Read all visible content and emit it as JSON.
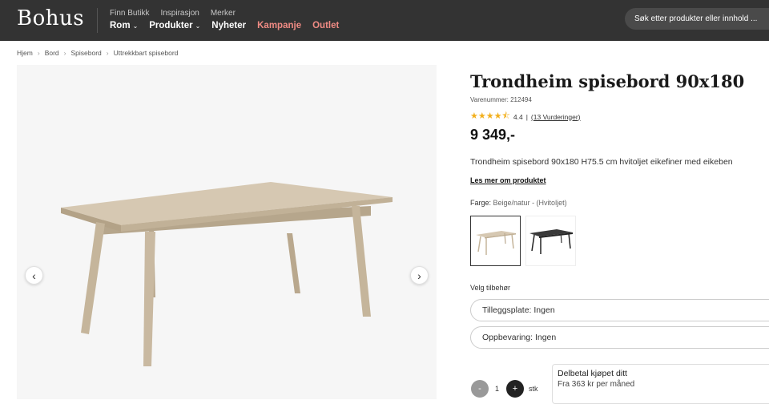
{
  "header": {
    "logo": "Bohus",
    "top_links": [
      "Finn Butikk",
      "Inspirasjon",
      "Merker"
    ],
    "nav": {
      "rom": "Rom",
      "produkter": "Produkter",
      "nyheter": "Nyheter",
      "kampanje": "Kampanje",
      "outlet": "Outlet"
    },
    "search_placeholder": "Søk etter produkter eller innhold ..."
  },
  "breadcrumb": [
    "Hjem",
    "Bord",
    "Spisebord",
    "Uttrekkbart spisebord"
  ],
  "product": {
    "title": "Trondheim spisebord 90x180",
    "sku": "Varenummer: 212494",
    "rating_value": "4.4",
    "rating_sep": "|",
    "reviews": "(13 Vurderinger)",
    "price": "9 349,-",
    "description": "Trondheim spisebord 90x180 H75.5 cm hvitoljet eikefiner med eikeben",
    "read_more": "Les mer om produktet",
    "color_label": "Farge:",
    "color_value": "Beige/natur - (Hvitoljet)",
    "accessories_label": "Velg tilbehør",
    "option_leaf": "Tilleggsplate: Ingen",
    "option_storage": "Oppbevaring: Ingen",
    "qty": "1",
    "qty_minus": "-",
    "qty_plus": "+",
    "qty_unit": "stk",
    "finance_title": "Delbetal kjøpet ditt",
    "finance_sub": "Fra 363 kr per måned"
  },
  "colors": {
    "header_bg": "#333333",
    "promo": "#f08b84",
    "star": "#f2b01e",
    "wood": "#c9b9a1"
  }
}
